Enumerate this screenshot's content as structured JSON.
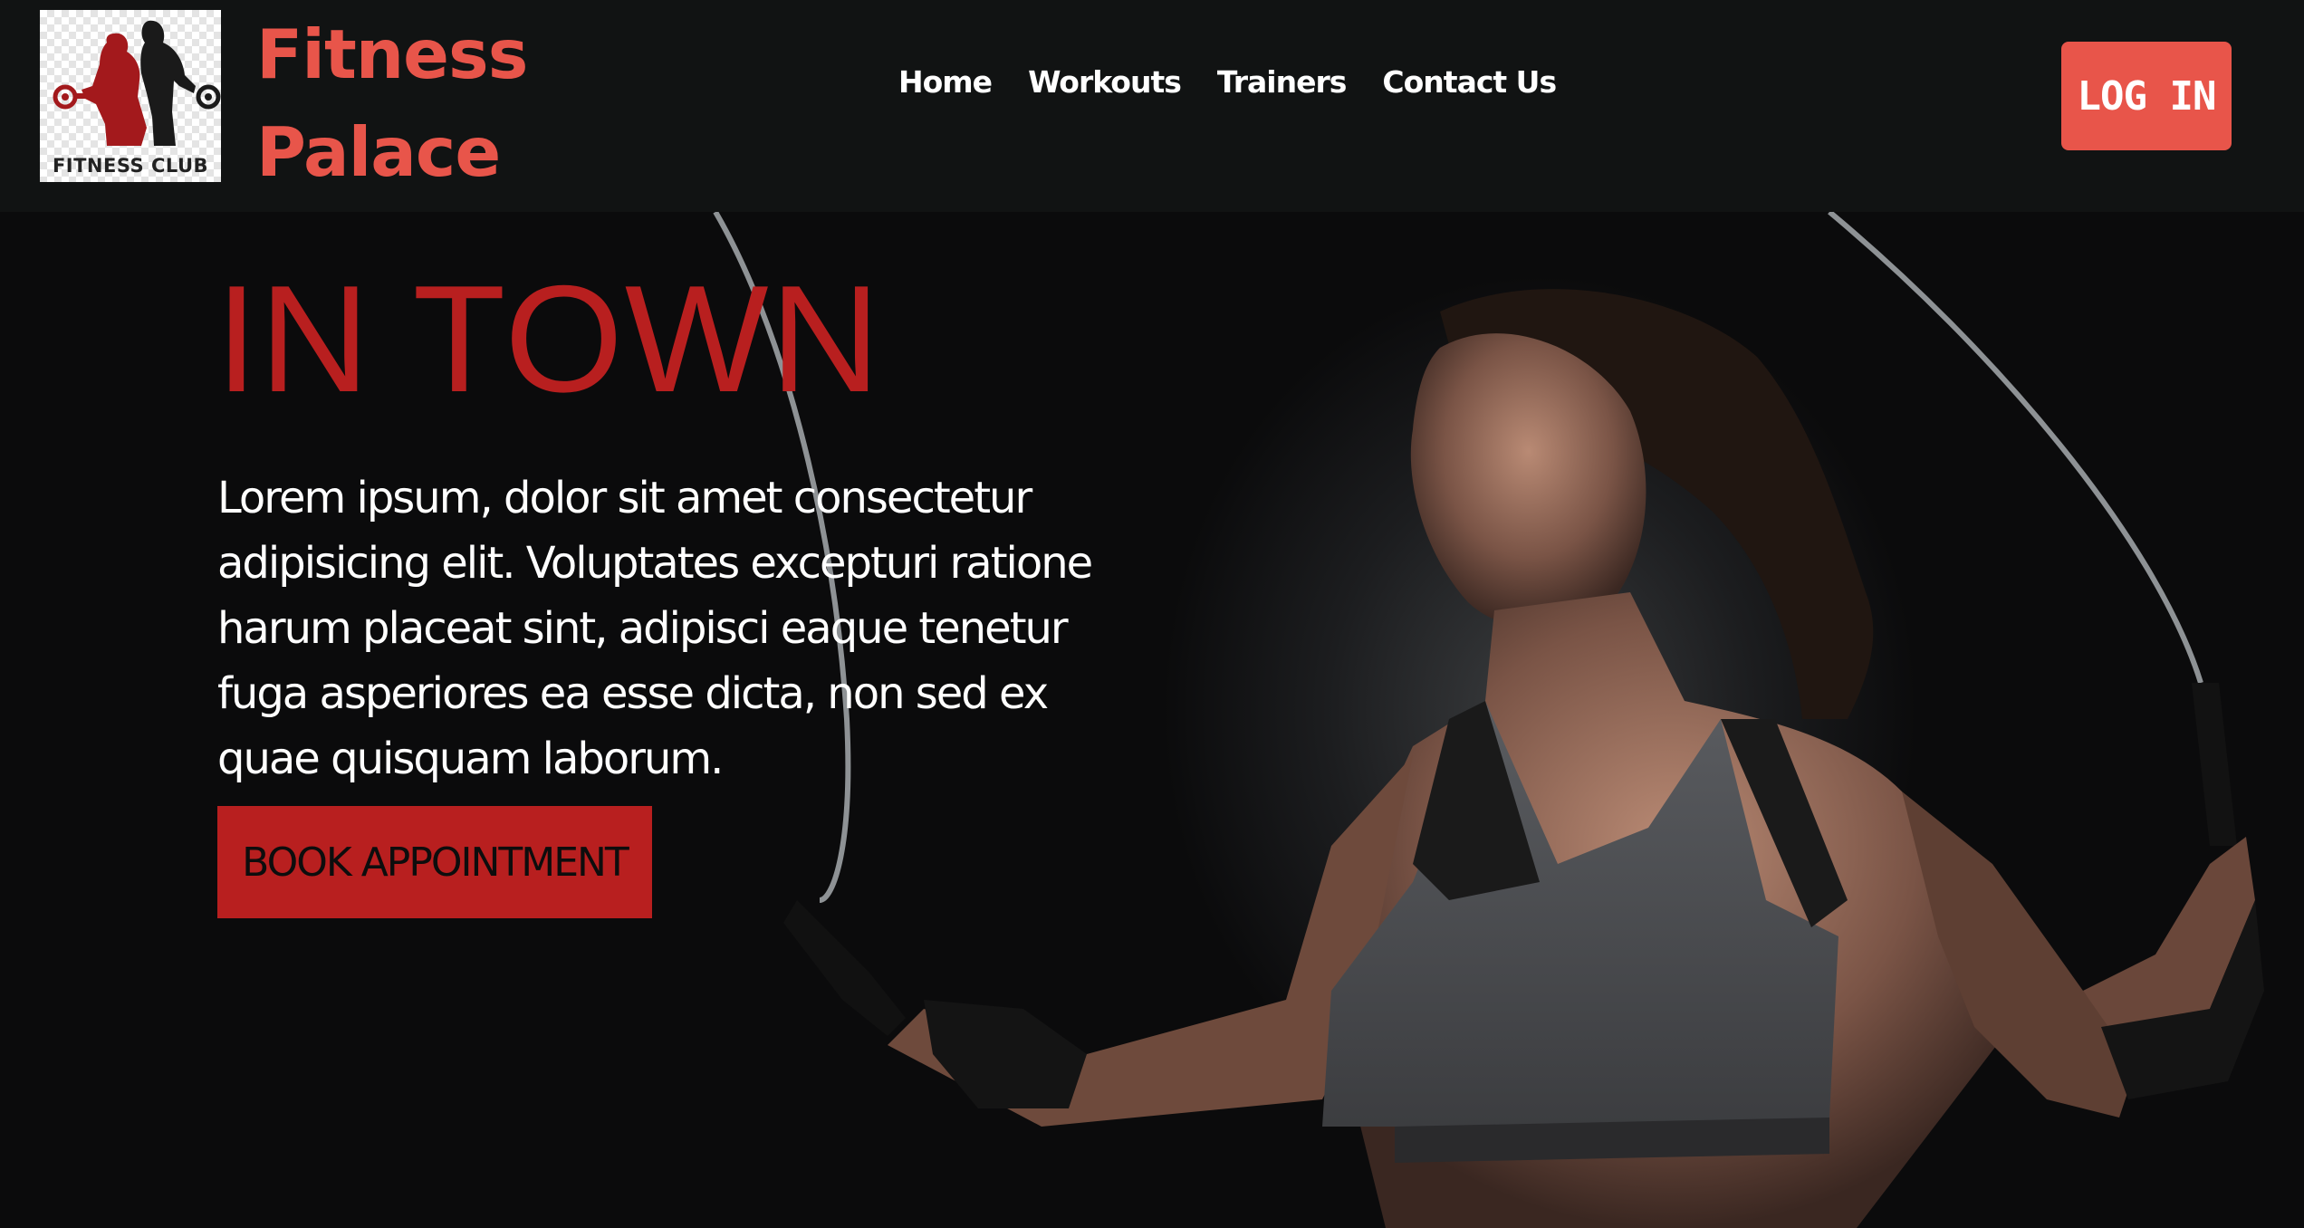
{
  "header": {
    "logo_caption": "FITNESS CLUB",
    "brand_line1": "Fitness",
    "brand_line2": "Palace",
    "nav": [
      "Home",
      "Workouts",
      "Trainers",
      "Contact Us"
    ],
    "login_label": "LOG IN"
  },
  "hero": {
    "title": "IN TOWN",
    "text": "Lorem ipsum, dolor sit amet consectetur adipisicing elit. Voluptates excepturi ratione harum placeat sint, adipisci eaque tenetur fuga asperiores ea esse dicta, non sed ex quae quisquam laborum.",
    "cta_label": "BOOK APPOINTMENT"
  },
  "colors": {
    "accent": "#e8554a",
    "hero_red": "#b81f1f",
    "header_bg": "#111313"
  }
}
